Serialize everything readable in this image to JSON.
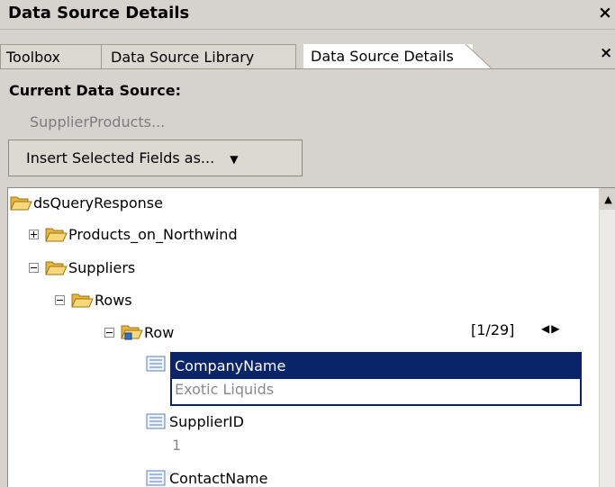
{
  "window": {
    "title": "Data Source Details",
    "close_glyph": "×"
  },
  "tabs": [
    {
      "label": "Toolbox"
    },
    {
      "label": "Data Source Library"
    },
    {
      "label": "Data Source Details",
      "active": true
    }
  ],
  "tab_close_glyph": "×",
  "current_source": {
    "label": "Current Data Source:",
    "value": "SupplierProducts..."
  },
  "insert_button": {
    "label": "Insert Selected Fields as...",
    "arrow": "▼"
  },
  "tree": {
    "root": {
      "label": "dsQueryResponse",
      "icon": "folder-open-icon"
    },
    "products": {
      "label": "Products_on_Northwind",
      "expanded": false,
      "icon": "folder-open-icon"
    },
    "suppliers": {
      "label": "Suppliers",
      "expanded": true,
      "icon": "folder-open-icon"
    },
    "rows": {
      "label": "Rows",
      "expanded": true,
      "icon": "folder-open-icon"
    },
    "row": {
      "label": "Row",
      "expanded": true,
      "icon": "folder-repeat-icon",
      "counter": "[1/29]",
      "nav": "◀▶"
    },
    "fields": [
      {
        "label": "CompanyName",
        "value": "Exotic Liquids",
        "selected": true
      },
      {
        "label": "SupplierID",
        "value": "1",
        "selected": false
      },
      {
        "label": "ContactName",
        "value": "",
        "selected": false
      }
    ]
  },
  "scrollbar": {
    "up_glyph": "▲"
  },
  "colors": {
    "selection": "#0a246a",
    "panel": "#d6d3ce",
    "folder": "#f4c64a"
  }
}
